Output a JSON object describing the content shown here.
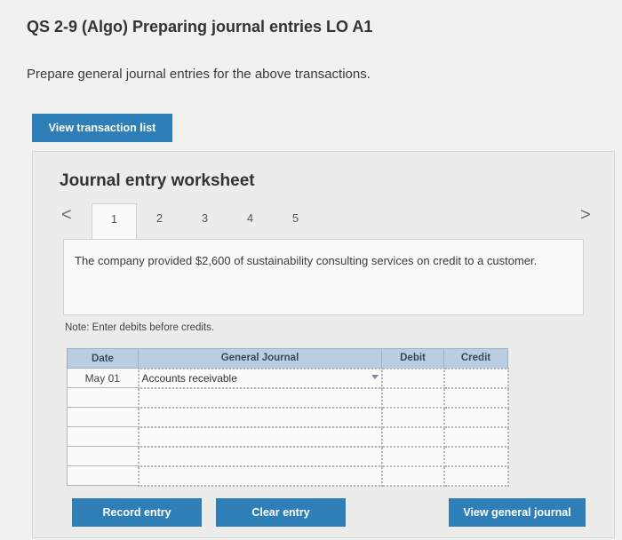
{
  "header": {
    "title": "QS 2-9 (Algo) Preparing journal entries LO A1",
    "instructions": "Prepare general journal entries for the above transactions."
  },
  "buttons": {
    "view_transaction_list": "View transaction list",
    "record_entry": "Record entry",
    "clear_entry": "Clear entry",
    "view_general_journal": "View general journal"
  },
  "worksheet": {
    "title": "Journal entry worksheet",
    "prev_arrow": "<",
    "next_arrow": ">",
    "tabs": [
      "1",
      "2",
      "3",
      "4",
      "5"
    ],
    "active_tab": "1",
    "description": "The company provided $2,600 of sustainability consulting services on credit to a customer.",
    "note": "Note: Enter debits before credits."
  },
  "journal": {
    "headers": {
      "date": "Date",
      "general_journal": "General Journal",
      "debit": "Debit",
      "credit": "Credit"
    },
    "rows": [
      {
        "date": "May 01",
        "account": "Accounts receivable",
        "debit": "",
        "credit": ""
      },
      {
        "date": "",
        "account": "",
        "debit": "",
        "credit": ""
      },
      {
        "date": "",
        "account": "",
        "debit": "",
        "credit": ""
      },
      {
        "date": "",
        "account": "",
        "debit": "",
        "credit": ""
      },
      {
        "date": "",
        "account": "",
        "debit": "",
        "credit": ""
      },
      {
        "date": "",
        "account": "",
        "debit": "",
        "credit": ""
      }
    ]
  },
  "colors": {
    "accent": "#2e7fb7",
    "table_header": "#b9cfe1"
  }
}
